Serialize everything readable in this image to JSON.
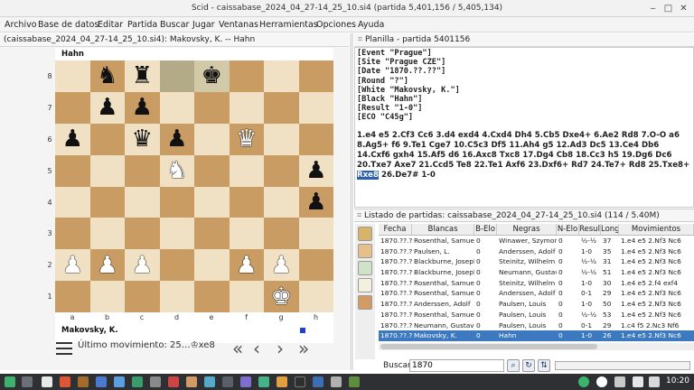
{
  "window": {
    "title": "Scid - caissabase_2024_04_27-14_25_10.si4 (partida 5,401,156 / 5,405,134)",
    "min_icon": "minimize-icon",
    "max_icon": "maximize-icon",
    "close_icon": "close-icon"
  },
  "menu": [
    "Archivo",
    "Base de datos",
    "Editar",
    "Partida",
    "Buscar",
    "Jugar",
    "Ventanas",
    "Herramientas",
    "Opciones",
    "Ayuda"
  ],
  "left_header": "(caissabase_2024_04_27-14_25_10.si4): Makovsky, K. -- Hahn",
  "board": {
    "black_player": "Hahn",
    "white_player": "Makovsky, K.",
    "ranks": [
      "8",
      "7",
      "6",
      "5",
      "4",
      "3",
      "2",
      "1"
    ],
    "files": [
      "a",
      "b",
      "c",
      "d",
      "e",
      "f",
      "g",
      "h"
    ],
    "position": [
      [
        "",
        "bn",
        "br",
        "",
        "bk",
        "",
        "",
        ""
      ],
      [
        "",
        "bp",
        "bp",
        "",
        "",
        "",
        "",
        ""
      ],
      [
        "bp",
        "",
        "bq",
        "bp",
        "",
        "wq",
        "",
        ""
      ],
      [
        "",
        "",
        "",
        "wn",
        "",
        "",
        "",
        "bp"
      ],
      [
        "",
        "",
        "",
        "",
        "",
        "",
        "",
        "bp"
      ],
      [
        "",
        "",
        "",
        "",
        "",
        "",
        "",
        ""
      ],
      [
        "wp",
        "wp",
        "wp",
        "",
        "",
        "wp",
        "wp",
        ""
      ],
      [
        "",
        "",
        "",
        "",
        "",
        "",
        "wk",
        ""
      ]
    ],
    "highlight": [
      "d8",
      "e8"
    ],
    "colors": {
      "light": "#f0e0c4",
      "dark": "#c99c63"
    }
  },
  "controls": {
    "last_move": "Último movimiento: 25…♔xe8",
    "menu_icon": "hamburger-menu-icon",
    "first": "«",
    "prev": "‹",
    "next": "›",
    "last": "»"
  },
  "pgn": {
    "header": "Planilla - partida 5401156",
    "tags": [
      "[Event \"Prague\"]",
      "[Site \"Prague CZE\"]",
      "[Date \"1870.??.??\"]",
      "[Round \"?\"]",
      "[White \"Makovsky, K.\"]",
      "[Black \"Hahn\"]",
      "[Result \"1-0\"]",
      "[ECO \"C45g\"]"
    ],
    "moves_before": "1.e4 e5 2.Cf3 Cc6 3.d4 exd4 4.Cxd4 Dh4 5.Cb5 Dxe4+ 6.Ae2 Rd8 7.O-O a6 8.Ag5+ f6 9.Te1 Cge7 10.C5c3 Df5 11.Ah4 g5 12.Ad3 Dc5 13.Ce4 Db6 14.Cxf6 gxh4 15.Af5 d6 16.Axc8 Txc8 17.Dg4 Cb8 18.Cc3 h5 19.Dg6 Dc6 20.Txe7 Axe7 21.Ccd5 Te8 22.Te1 Axf6 23.Dxf6+ Rd7 24.Te7+ Rd8 25.Txe8+",
    "current_move": "Rxe8",
    "moves_after": "26.De7# 1-0"
  },
  "list": {
    "header": "Listado de partidas: caissabase_2024_04_27-14_25_10.si4 (114 / 5.40M)",
    "columns": [
      "Fecha",
      "Blancas",
      "B-Elo",
      "Negras",
      "N-Elo",
      "Resultado",
      "Long",
      "Movimientos"
    ],
    "rows": [
      [
        "1870.??.??",
        "Rosenthal, Samuel",
        "0",
        "Winawer, Szymon",
        "0",
        "½-½",
        "37",
        "1.e4 e5 2.Nf3 Nc6"
      ],
      [
        "1870.??.??",
        "Paulsen, L.",
        "0",
        "Anderssen, Adolf",
        "0",
        "1-0",
        "35",
        "1.e4 e5 2.Nf3 Nc6"
      ],
      [
        "1870.??.??",
        "Blackburne, Joseph",
        "0",
        "Steinitz, Wilhelm",
        "0",
        "½-½",
        "31",
        "1.e4 e5 2.Nf3 Nc6"
      ],
      [
        "1870.??.??",
        "Blackburne, Joseph",
        "0",
        "Neumann, Gustav",
        "0",
        "½-½",
        "51",
        "1.e4 e5 2.Nf3 Nc6"
      ],
      [
        "1870.??.??",
        "Rosenthal, Samuel",
        "0",
        "Steinitz, Wilhelm",
        "0",
        "1-0",
        "30",
        "1.e4 e5 2.f4 exf4"
      ],
      [
        "1870.??.??",
        "Rosenthal, Samuel",
        "0",
        "Anderssen, Adolf",
        "0",
        "0-1",
        "29",
        "1.e4 e5 2.Nf3 Nc6"
      ],
      [
        "1870.??.??",
        "Anderssen, Adolf",
        "0",
        "Paulsen, Louis",
        "0",
        "1-0",
        "50",
        "1.e4 e5 2.Nf3 Nc6"
      ],
      [
        "1870.??.??",
        "Rosenthal, Samuel",
        "0",
        "Paulsen, Louis",
        "0",
        "½-½",
        "53",
        "1.e4 e5 2.Nf3 Nc6"
      ],
      [
        "1870.??.??",
        "Neumann, Gustav",
        "0",
        "Paulsen, Louis",
        "0",
        "0-1",
        "29",
        "1.c4 f5 2.Nc3 Nf6"
      ],
      [
        "1870.??.??",
        "Makovsky, K.",
        "0",
        "Hahn",
        "0",
        "1-0",
        "26",
        "1.e4 e5 2.Nf3 Nc6"
      ]
    ],
    "selected_row": 9
  },
  "search": {
    "label": "Buscar",
    "value": "1870"
  },
  "taskbar": {
    "time": "10:20"
  }
}
